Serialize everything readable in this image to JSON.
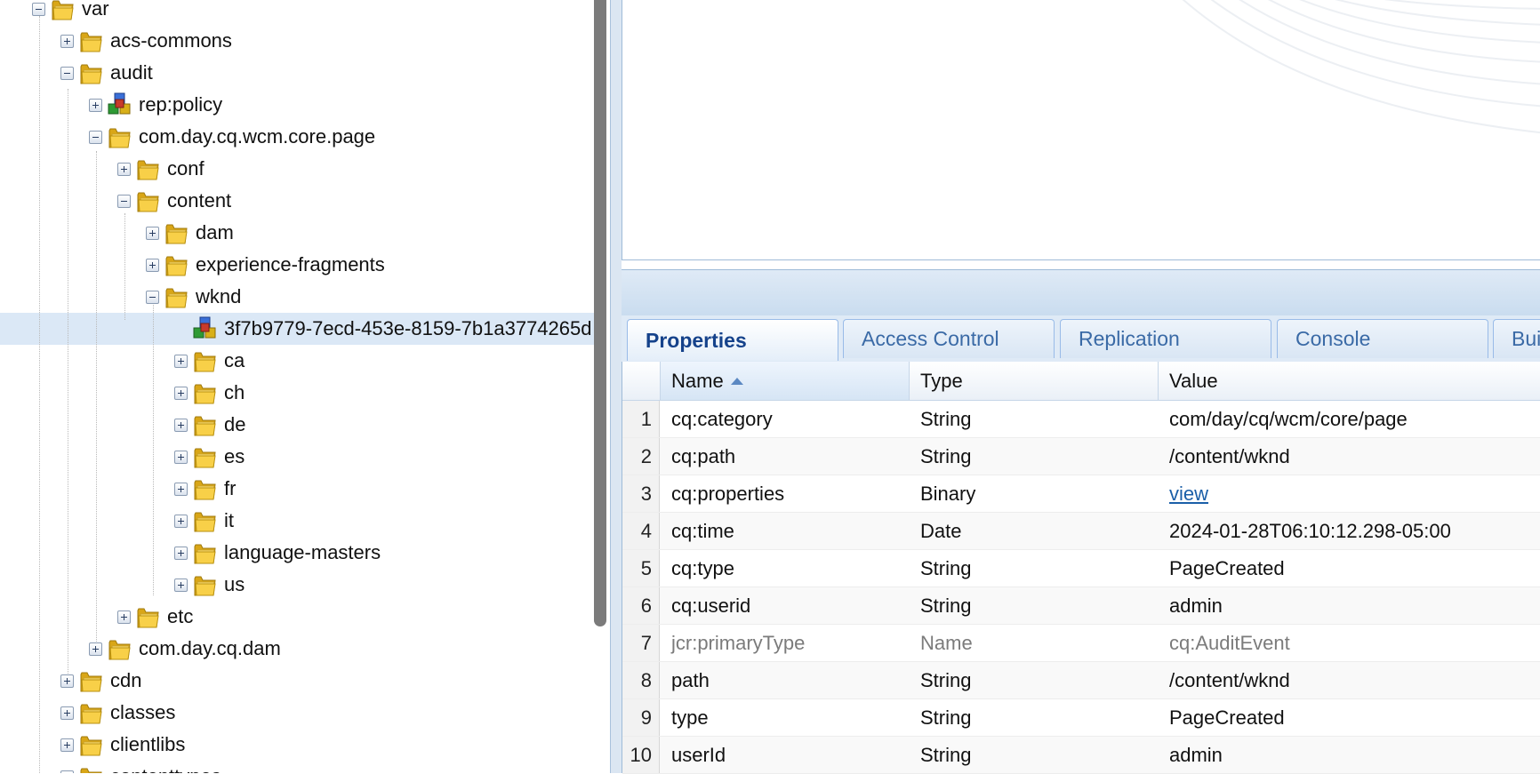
{
  "tree": {
    "nodes": [
      {
        "label": "var",
        "icon": "folder-icon",
        "expander": "minus"
      },
      {
        "label": "acs-commons",
        "icon": "folder-icon",
        "expander": "plus"
      },
      {
        "label": "audit",
        "icon": "folder-icon",
        "expander": "minus"
      },
      {
        "label": "rep:policy",
        "icon": "policy-node-icon",
        "expander": "plus"
      },
      {
        "label": "com.day.cq.wcm.core.page",
        "icon": "folder-icon",
        "expander": "minus"
      },
      {
        "label": "conf",
        "icon": "folder-icon",
        "expander": "plus"
      },
      {
        "label": "content",
        "icon": "folder-icon",
        "expander": "minus"
      },
      {
        "label": "dam",
        "icon": "folder-icon",
        "expander": "plus"
      },
      {
        "label": "experience-fragments",
        "icon": "folder-icon",
        "expander": "plus"
      },
      {
        "label": "wknd",
        "icon": "folder-icon",
        "expander": "minus"
      },
      {
        "label": "3f7b9779-7ecd-453e-8159-7b1a3774265d",
        "icon": "audit-event-node-icon",
        "expander": "none",
        "selected": true
      },
      {
        "label": "ca",
        "icon": "folder-icon",
        "expander": "plus"
      },
      {
        "label": "ch",
        "icon": "folder-icon",
        "expander": "plus"
      },
      {
        "label": "de",
        "icon": "folder-icon",
        "expander": "plus"
      },
      {
        "label": "es",
        "icon": "folder-icon",
        "expander": "plus"
      },
      {
        "label": "fr",
        "icon": "folder-icon",
        "expander": "plus"
      },
      {
        "label": "it",
        "icon": "folder-icon",
        "expander": "plus"
      },
      {
        "label": "language-masters",
        "icon": "folder-icon",
        "expander": "plus"
      },
      {
        "label": "us",
        "icon": "folder-icon",
        "expander": "plus"
      },
      {
        "label": "etc",
        "icon": "folder-icon",
        "expander": "plus"
      },
      {
        "label": "com.day.cq.dam",
        "icon": "folder-icon",
        "expander": "plus"
      },
      {
        "label": "cdn",
        "icon": "folder-icon",
        "expander": "plus"
      },
      {
        "label": "classes",
        "icon": "folder-icon",
        "expander": "plus"
      },
      {
        "label": "clientlibs",
        "icon": "folder-icon",
        "expander": "plus"
      },
      {
        "label": "contenttypes",
        "icon": "folder-icon",
        "expander": "plus"
      }
    ]
  },
  "tabs": [
    "Properties",
    "Access Control",
    "Replication",
    "Console",
    "Bui"
  ],
  "active_tab": "Properties",
  "grid": {
    "columns": {
      "name": "Name",
      "type": "Type",
      "value": "Value"
    },
    "sorted_column": "Name",
    "rows": [
      {
        "num": "1",
        "name": "cq:category",
        "type": "String",
        "value": "com/day/cq/wcm/core/page"
      },
      {
        "num": "2",
        "name": "cq:path",
        "type": "String",
        "value": "/content/wknd"
      },
      {
        "num": "3",
        "name": "cq:properties",
        "type": "Binary",
        "value": "view",
        "link": true
      },
      {
        "num": "4",
        "name": "cq:time",
        "type": "Date",
        "value": "2024-01-28T06:10:12.298-05:00"
      },
      {
        "num": "5",
        "name": "cq:type",
        "type": "String",
        "value": "PageCreated"
      },
      {
        "num": "6",
        "name": "cq:userid",
        "type": "String",
        "value": "admin"
      },
      {
        "num": "7",
        "name": "jcr:primaryType",
        "type": "Name",
        "value": "cq:AuditEvent",
        "muted": true
      },
      {
        "num": "8",
        "name": "path",
        "type": "String",
        "value": "/content/wknd"
      },
      {
        "num": "9",
        "name": "type",
        "type": "String",
        "value": "PageCreated"
      },
      {
        "num": "10",
        "name": "userId",
        "type": "String",
        "value": "admin"
      }
    ]
  },
  "colors": {
    "selection": "#dbe8f6",
    "tab_active_text": "#15428b",
    "tab_text": "#3a6aa6",
    "border": "#99bbe8"
  }
}
